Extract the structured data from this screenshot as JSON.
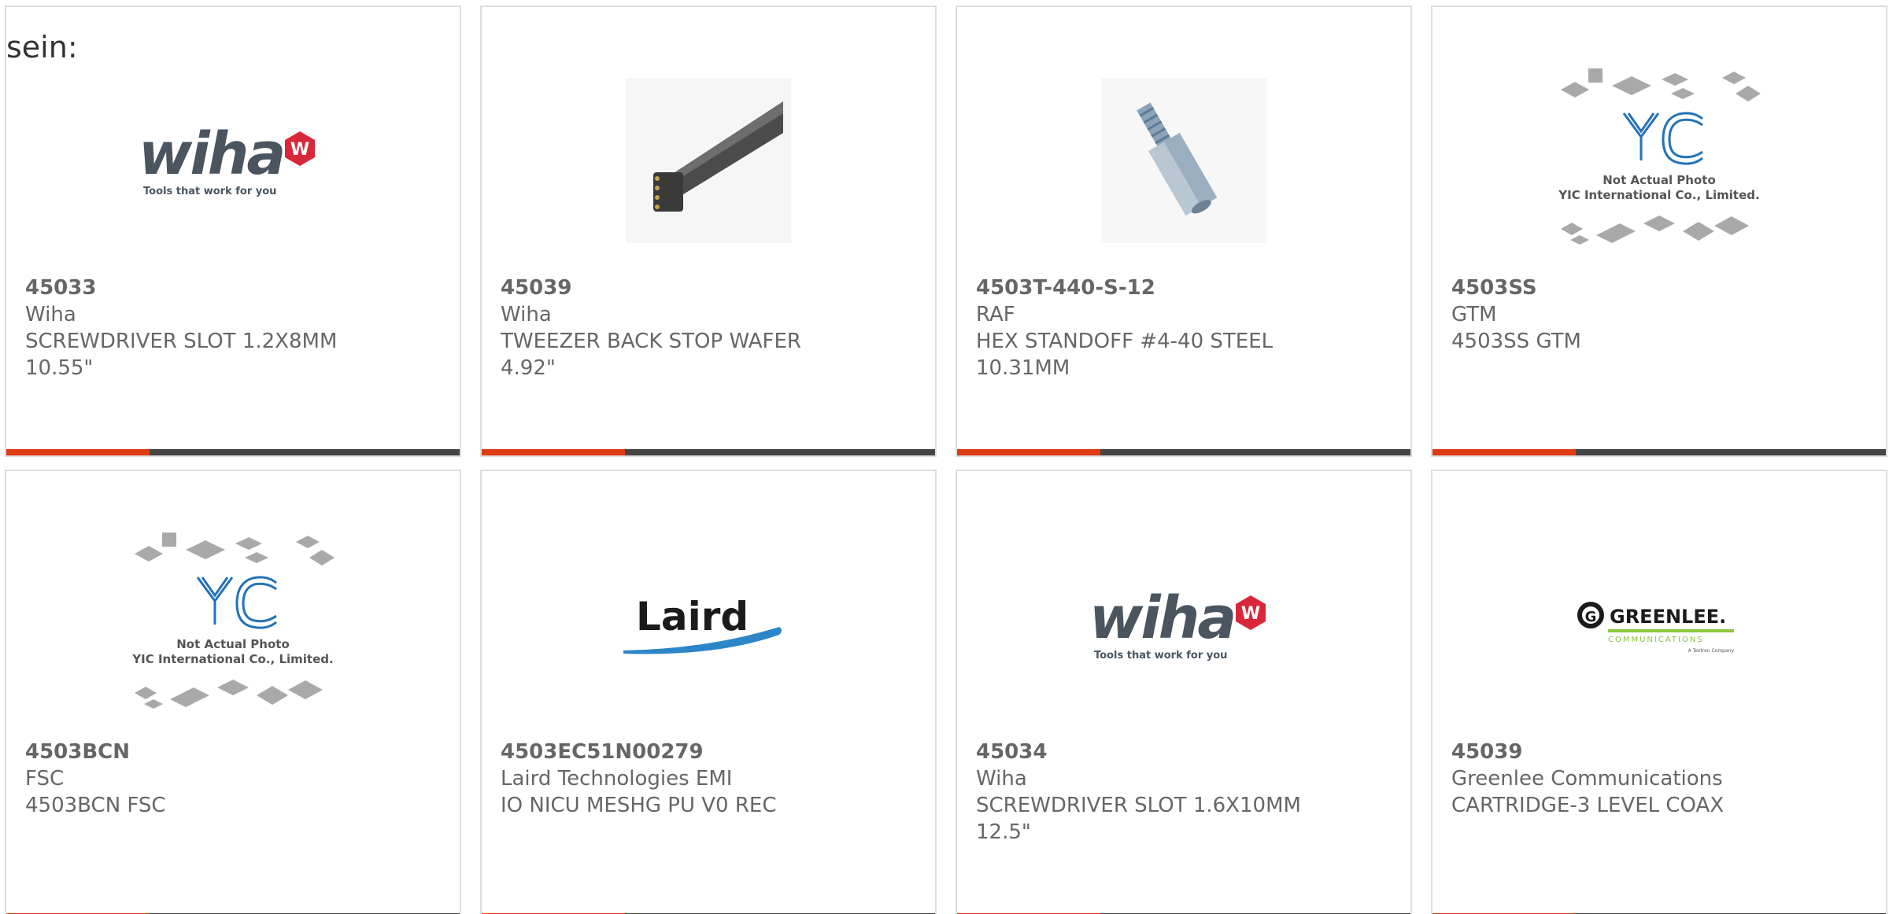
{
  "intro_text": "sein:",
  "colors": {
    "accent": "#e03c14",
    "bar": "#444444",
    "text": "#666666",
    "border": "#dddddd"
  },
  "logos": {
    "wiha_tagline": "Tools that work for you",
    "yic_line1": "Not Actual Photo",
    "yic_line2": "YIC International Co., Limited.",
    "laird": "Laird",
    "greenlee": "GREENLEE.",
    "greenlee_sub": "COMMUNICATIONS",
    "greenlee_tag": "A Textron Company"
  },
  "products": [
    {
      "part": "45033",
      "maker": "Wiha",
      "desc": "SCREWDRIVER SLOT 1.2X8MM",
      "extra": "10.55\"",
      "image": "wiha-logo"
    },
    {
      "part": "45039",
      "maker": "Wiha",
      "desc": "TWEEZER BACK STOP WAFER",
      "extra": "4.92\"",
      "image": "tweezer-photo"
    },
    {
      "part": "4503T-440-S-12",
      "maker": "RAF",
      "desc": "HEX STANDOFF #4-40 STEEL",
      "extra": "10.31MM",
      "image": "standoff-photo"
    },
    {
      "part": "4503SS",
      "maker": "GTM",
      "desc": "4503SS GTM",
      "extra": "",
      "image": "yic-placeholder"
    },
    {
      "part": "4503BCN",
      "maker": "FSC",
      "desc": "4503BCN FSC",
      "extra": "",
      "image": "yic-placeholder"
    },
    {
      "part": "4503EC51N00279",
      "maker": "Laird Technologies EMI",
      "desc": "IO NICU MESHG PU V0 REC",
      "extra": "",
      "image": "laird-logo"
    },
    {
      "part": "45034",
      "maker": "Wiha",
      "desc": "SCREWDRIVER SLOT 1.6X10MM",
      "extra": "12.5\"",
      "image": "wiha-logo"
    },
    {
      "part": "45039",
      "maker": "Greenlee Communications",
      "desc": "CARTRIDGE-3 LEVEL COAX",
      "extra": "",
      "image": "greenlee-logo"
    }
  ]
}
